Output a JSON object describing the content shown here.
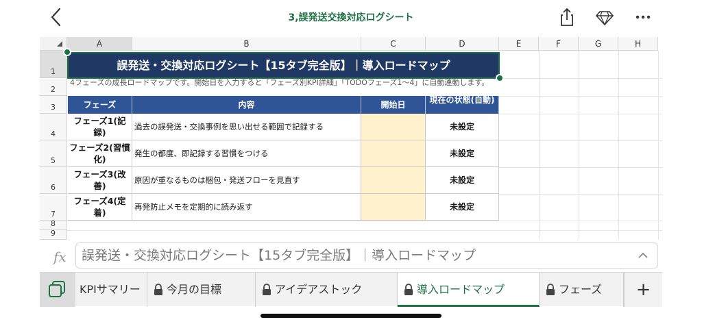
{
  "header": {
    "document_title": "3,誤発送交換対応ログシート",
    "icons": [
      "back-chevron-icon",
      "share-icon",
      "diamond-icon",
      "more-icon"
    ]
  },
  "sheet": {
    "columns": [
      "A",
      "B",
      "C",
      "D",
      "E",
      "F",
      "G",
      "H"
    ],
    "rows": [
      "1",
      "2",
      "3",
      "4",
      "5",
      "6",
      "7",
      "8",
      "9"
    ],
    "selected_column": "A",
    "selected_row": "1",
    "title": "誤発送・交換対応ログシート【15タブ完全版】｜導入ロードマップ",
    "description": "4フェーズの成長ロードマップです。開始日を入力すると「フェーズ別KPI詳細」「TODOフェーズ1〜4」に自動連動します。",
    "table": {
      "headers": [
        "フェーズ",
        "内容",
        "開始日",
        "現在の状態(自動)"
      ],
      "rows": [
        {
          "phase": "フェーズ1(記録)",
          "content": "過去の誤発送・交換事例を思い出せる範囲で記録する",
          "start": "",
          "state": "未設定"
        },
        {
          "phase": "フェーズ2(習慣化)",
          "content": "発生の都度、即記録する習慣をつける",
          "start": "",
          "state": "未設定"
        },
        {
          "phase": "フェーズ3(改善)",
          "content": "原因が重なるものは梱包・発送フローを見直す",
          "start": "",
          "state": "未設定"
        },
        {
          "phase": "フェーズ4(定着)",
          "content": "再発防止メモを定期的に読み返す",
          "start": "",
          "state": "未設定"
        }
      ]
    }
  },
  "formula_bar": {
    "fx_label": "fx",
    "value": "誤発送・交換対応ログシート【15タブ完全版】｜導入ロードマップ"
  },
  "tabs": {
    "items": [
      {
        "label": "KPIサマリー",
        "locked": false,
        "active": false
      },
      {
        "label": "今月の目標",
        "locked": true,
        "active": false
      },
      {
        "label": "アイデアストック",
        "locked": true,
        "active": false
      },
      {
        "label": "導入ロードマップ",
        "locked": true,
        "active": true
      },
      {
        "label": "フェーズ",
        "locked": true,
        "active": false
      }
    ],
    "add_label": "+"
  },
  "colors": {
    "accent_green": "#1e7145",
    "title_navy": "#1f3864",
    "header_blue": "#2f5597",
    "input_yellow": "#fff2cc"
  }
}
